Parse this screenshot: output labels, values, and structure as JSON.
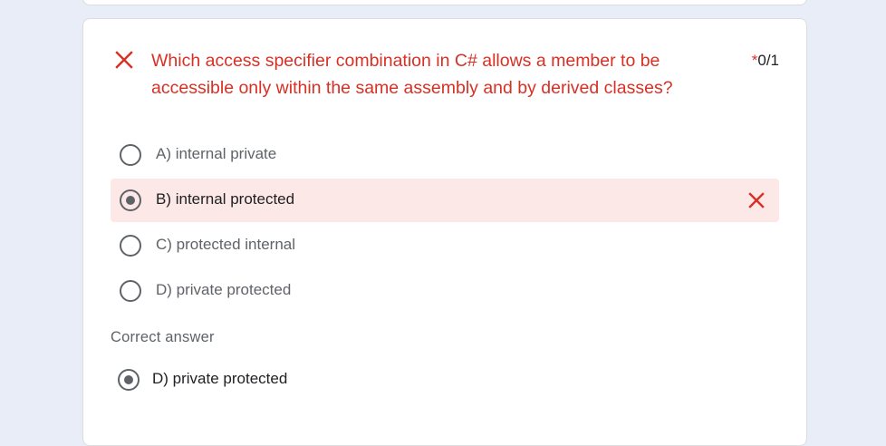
{
  "question": {
    "status_icon": "close-icon",
    "text": "Which access specifier combination in C# allows a member to be accessible only within the same assembly and by derived classes?",
    "required_marker": "*",
    "score": "0/1",
    "colors": {
      "incorrect": "#d93025",
      "selected_background": "#fce8e6"
    }
  },
  "options": [
    {
      "label": "A) internal private",
      "selected": false
    },
    {
      "label": "B) internal protected",
      "selected": true,
      "result_icon": "close-icon"
    },
    {
      "label": "C) protected internal",
      "selected": false
    },
    {
      "label": "D) private protected",
      "selected": false
    }
  ],
  "feedback": {
    "title": "Correct answer",
    "answer_label": "D) private protected"
  }
}
